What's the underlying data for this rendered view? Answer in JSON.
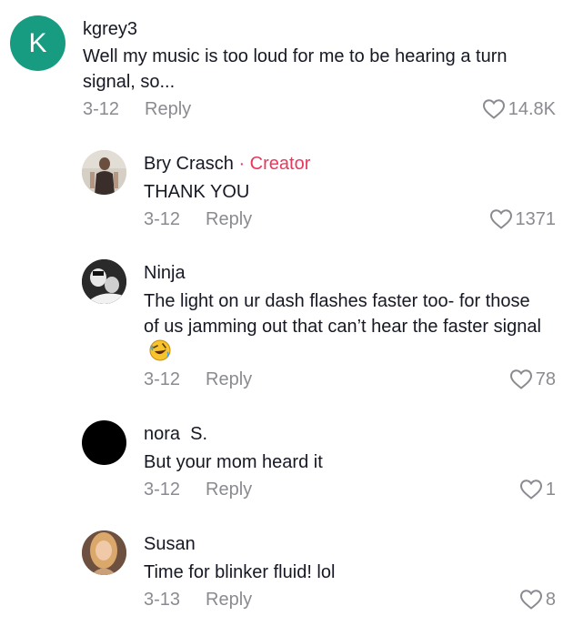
{
  "comments": [
    {
      "avatar_letter": "K",
      "username": "kgrey3",
      "text": "Well my music is too loud for me to be hearing a turn signal, so...",
      "date": "3-12",
      "reply": "Reply",
      "likes": "14.8K",
      "avatar_color": "#179c82"
    },
    {
      "username": "Bry Crasch",
      "creator_label": "· Creator",
      "text": "THANK YOU",
      "date": "3-12",
      "reply": "Reply",
      "likes": "1371"
    },
    {
      "username": "Ninja",
      "text": "The light on ur dash flashes faster too- for those of us jamming out that can’t hear the faster signal",
      "emoji": "rolling-on-floor-laughing",
      "date": "3-12",
      "reply": "Reply",
      "likes": "78"
    },
    {
      "username": "nora  S.",
      "text": "But your mom heard it",
      "date": "3-12",
      "reply": "Reply",
      "likes": "1",
      "avatar_color": "#000000"
    },
    {
      "username": "Susan",
      "text": "Time for blinker fluid! lol",
      "date": "3-13",
      "reply": "Reply",
      "likes": "8"
    }
  ],
  "colors": {
    "creator": "#e8385c",
    "meta": "#8a8b91",
    "text": "#161823"
  }
}
